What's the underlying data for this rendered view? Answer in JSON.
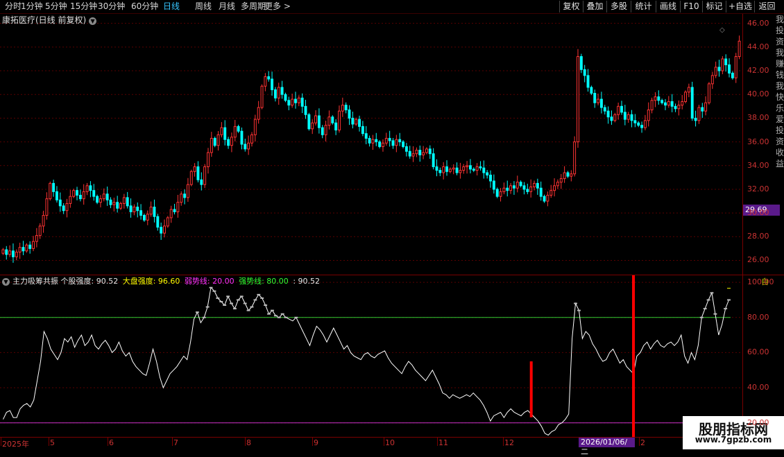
{
  "toolbar": {
    "periods": [
      "分时",
      "1分钟",
      "5分钟",
      "15分钟",
      "30分钟",
      "60分钟",
      "日线",
      "周线",
      "月线",
      "多周期",
      "更多 >"
    ],
    "active_period": "日线",
    "buttons": [
      "复权",
      "叠加",
      "多股",
      "统计",
      "画线",
      "F10",
      "标记",
      "+自选",
      "返回"
    ]
  },
  "main": {
    "title": "康拓医疗(日线 前复权)",
    "price_tag": "29.69"
  },
  "indicator": {
    "name": "主力吸筹共振",
    "labels": [
      {
        "text": "个股强度: 90.52",
        "color": "#e8e8e8"
      },
      {
        "text": "大盘强度: 96.60",
        "color": "#ffff00"
      },
      {
        "text": "弱势线: 20.00",
        "color": "#ff33ff"
      },
      {
        "text": "强势线: 80.00",
        "color": "#33ff33"
      },
      {
        "text": ": 90.52",
        "color": "#e8e8e8"
      }
    ],
    "side_mark": "自"
  },
  "xaxis": {
    "labels": [
      "2025年",
      "5",
      "6",
      "7",
      "8",
      "9",
      "10",
      "11",
      "12",
      "2026/01/06/二",
      "2"
    ]
  },
  "watermark": {
    "line1": "股朋指标网",
    "line2": "www.7gpzb.com"
  },
  "side_strip": "我投资我赚钱我快乐爱投资收益",
  "colors": {
    "up": "#ff3333",
    "down": "#00ffff",
    "grid": "#7a0000",
    "strong": "#33cc33",
    "weak": "#cc33cc",
    "line": "#ffffff"
  },
  "chart_data": [
    {
      "type": "candlestick",
      "title": "康拓医疗(日线 前复权)",
      "ylim": [
        24.8,
        46.8
      ],
      "yticks": [
        26.0,
        28.0,
        30.0,
        32.0,
        34.0,
        36.0,
        38.0,
        40.0,
        42.0,
        44.0,
        46.0
      ],
      "grid": true,
      "close": [
        26.9,
        26.5,
        26.8,
        26.3,
        26.7,
        27.1,
        26.8,
        27.3,
        27.0,
        27.6,
        28.1,
        28.9,
        29.8,
        31.2,
        32.5,
        31.8,
        31.1,
        30.6,
        30.2,
        30.8,
        31.4,
        31.9,
        31.5,
        31.2,
        31.8,
        32.3,
        31.9,
        31.4,
        30.9,
        31.2,
        31.6,
        31.1,
        30.7,
        30.9,
        30.4,
        30.8,
        31.3,
        30.6,
        30.1,
        30.5,
        30.2,
        29.8,
        29.4,
        29.9,
        30.5,
        29.7,
        28.8,
        28.3,
        28.9,
        29.6,
        30.3,
        30.1,
        30.9,
        31.6,
        31.3,
        32.4,
        33.5,
        33.9,
        32.8,
        32.4,
        33.9,
        35.1,
        36.3,
        35.7,
        36.6,
        37.2,
        36.2,
        35.7,
        36.4,
        37.3,
        36.9,
        35.8,
        35.4,
        35.9,
        36.6,
        37.9,
        38.9,
        40.7,
        41.5,
        41.3,
        40.4,
        39.7,
        40.6,
        40.0,
        39.5,
        39.1,
        39.6,
        39.3,
        39.7,
        39.0,
        38.3,
        37.1,
        37.6,
        38.2,
        37.2,
        36.6,
        37.4,
        38.1,
        37.6,
        37.0,
        38.6,
        39.1,
        38.7,
        38.0,
        37.5,
        37.9,
        37.3,
        36.7,
        36.3,
        35.9,
        36.2,
        36.0,
        35.6,
        35.9,
        36.3,
        36.1,
        35.7,
        36.2,
        36.0,
        35.6,
        35.2,
        34.8,
        35.0,
        35.3,
        34.9,
        35.1,
        35.4,
        35.0,
        33.9,
        33.6,
        33.4,
        33.9,
        33.5,
        33.7,
        33.8,
        33.4,
        33.6,
        33.9,
        34.0,
        33.7,
        33.6,
        33.9,
        33.8,
        33.4,
        33.2,
        32.7,
        32.0,
        31.4,
        31.8,
        32.1,
        31.9,
        32.3,
        32.1,
        32.6,
        32.3,
        32.0,
        31.8,
        32.2,
        32.5,
        32.1,
        31.4,
        31.0,
        31.5,
        31.9,
        32.3,
        32.6,
        32.9,
        33.4,
        33.1,
        33.3,
        36.0,
        43.2,
        42.1,
        41.6,
        40.6,
        40.1,
        39.3,
        39.6,
        38.9,
        38.6,
        38.1,
        37.8,
        38.3,
        39.0,
        38.5,
        37.9,
        38.3,
        37.8,
        37.6,
        37.4,
        37.2,
        37.8,
        38.7,
        39.5,
        39.8,
        39.5,
        39.3,
        39.1,
        39.4,
        39.0,
        38.8,
        39.1,
        39.4,
        40.2,
        40.6,
        38.0,
        37.8,
        38.9,
        38.6,
        39.3,
        40.9,
        41.6,
        42.3,
        42.0,
        43.0,
        42.5,
        41.8,
        41.4,
        43.2,
        44.5
      ]
    },
    {
      "type": "line",
      "title": "主力吸筹共振",
      "ylim": [
        12,
        104
      ],
      "yticks": [
        20.0,
        40.0,
        60.0,
        80.0,
        100.0
      ],
      "weak_line": 20.0,
      "strong_line": 80.0,
      "current_stock_strength": 90.52,
      "current_market_strength": 96.6,
      "series": [
        {
          "name": "个股强度",
          "values": [
            22,
            26,
            27,
            23,
            23,
            28,
            30,
            31,
            29,
            33,
            44,
            55,
            72,
            68,
            62,
            59,
            56,
            60,
            68,
            66,
            69,
            63,
            67,
            70,
            64,
            66,
            70,
            64,
            62,
            65,
            67,
            64,
            60,
            62,
            66,
            61,
            58,
            60,
            55,
            52,
            50,
            48,
            47,
            54,
            62,
            55,
            46,
            40,
            44,
            48,
            50,
            52,
            55,
            58,
            56,
            66,
            79,
            83,
            77,
            80,
            86,
            97,
            95,
            91,
            89,
            87,
            92,
            88,
            85,
            90,
            92,
            88,
            84,
            86,
            90,
            93,
            91,
            87,
            82,
            84,
            81,
            80,
            82,
            80,
            79,
            78,
            80,
            76,
            72,
            68,
            64,
            70,
            75,
            73,
            70,
            66,
            70,
            74,
            70,
            66,
            62,
            64,
            60,
            58,
            57,
            56,
            59,
            60,
            58,
            57,
            59,
            60,
            61,
            57,
            54,
            52,
            50,
            48,
            52,
            55,
            53,
            50,
            48,
            46,
            44,
            47,
            50,
            46,
            42,
            37,
            36,
            34,
            36,
            35,
            34,
            35,
            36,
            35,
            37,
            35,
            33,
            30,
            26,
            21,
            24,
            25,
            26,
            23,
            26,
            28,
            26,
            25,
            24,
            26,
            27,
            25,
            23,
            21,
            18,
            14,
            13,
            15,
            16,
            19,
            20,
            22,
            25,
            68,
            88,
            84,
            68,
            72,
            70,
            65,
            62,
            58,
            55,
            56,
            60,
            62,
            58,
            54,
            56,
            52,
            50,
            48,
            58,
            60,
            64,
            66,
            62,
            65,
            67,
            64,
            63,
            65,
            66,
            64,
            66,
            70,
            58,
            54,
            60,
            56,
            64,
            80,
            85,
            90,
            94,
            82,
            70,
            76,
            85,
            90
          ]
        }
      ]
    }
  ]
}
